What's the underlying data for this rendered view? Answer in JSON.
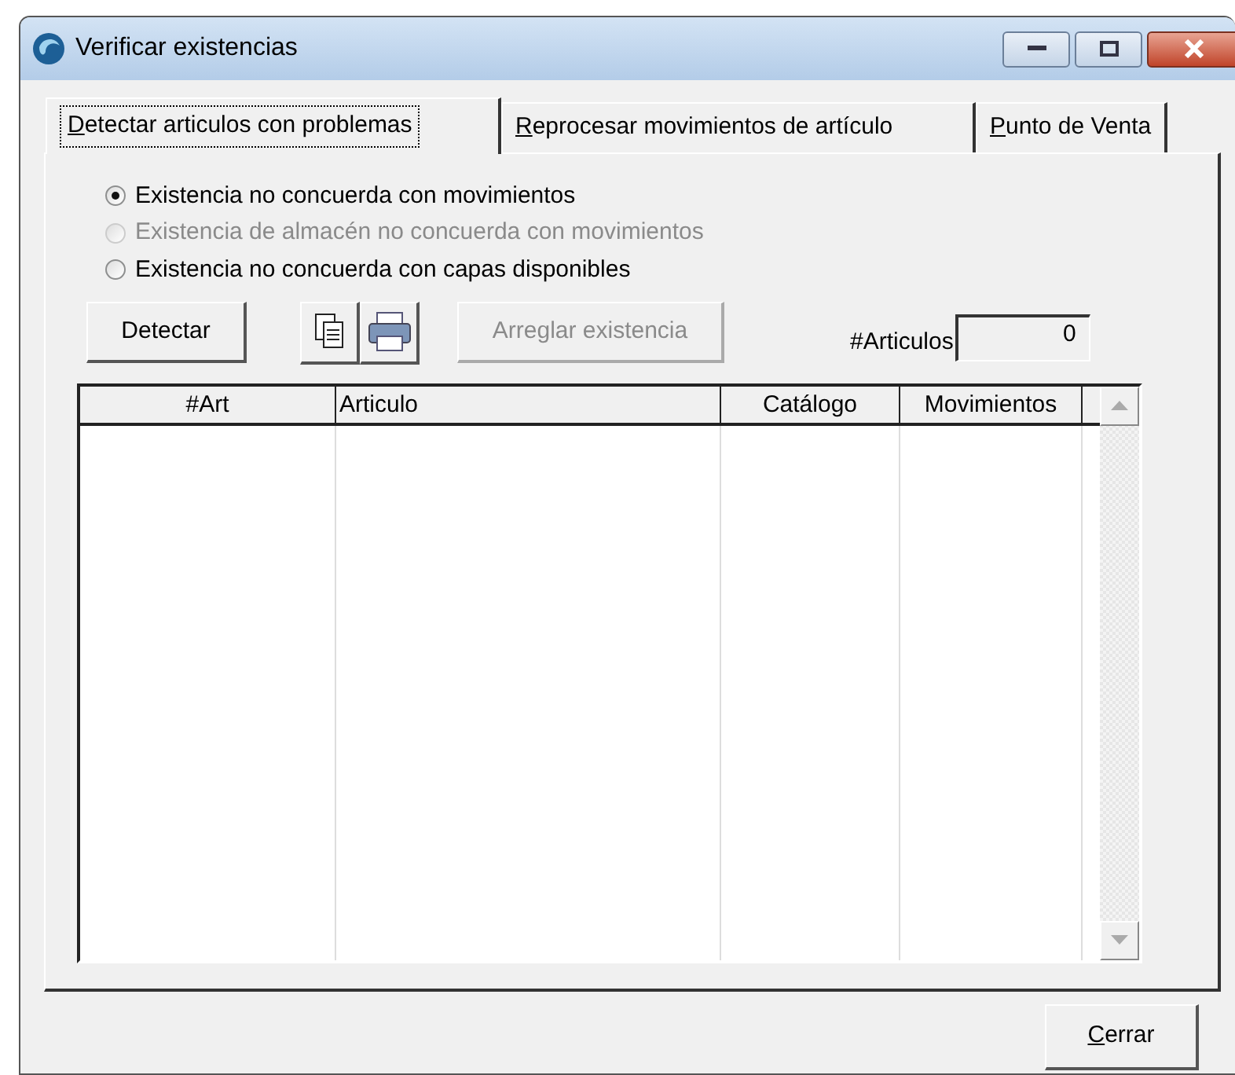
{
  "window": {
    "title": "Verificar existencias"
  },
  "tabs": [
    {
      "label": "Detectar articulos con problemas",
      "selected": true,
      "mnemonic": true
    },
    {
      "label": "Reprocesar movimientos de artículo",
      "selected": false,
      "mnemonic": true
    },
    {
      "label": "Punto de Venta",
      "selected": false,
      "mnemonic": true
    }
  ],
  "options": [
    {
      "label": "Existencia no concuerda con movimientos",
      "selected": true,
      "disabled": false
    },
    {
      "label": "Existencia de almacén no concuerda con movimientos",
      "selected": false,
      "disabled": true
    },
    {
      "label": "Existencia no concuerda con capas disponibles",
      "selected": false,
      "disabled": false
    }
  ],
  "detect_button": {
    "label": "Detectar",
    "disabled": false
  },
  "fix_button": {
    "label": "Arreglar existencia",
    "disabled": true
  },
  "count": {
    "label": "#Articulos",
    "value": "0"
  },
  "table": {
    "columns": [
      {
        "label": "#Art"
      },
      {
        "label": "Articulo"
      },
      {
        "label": "Catálogo"
      },
      {
        "label": "Movimientos"
      }
    ]
  },
  "close_button": {
    "label": "Cerrar",
    "mnemonic": true
  }
}
